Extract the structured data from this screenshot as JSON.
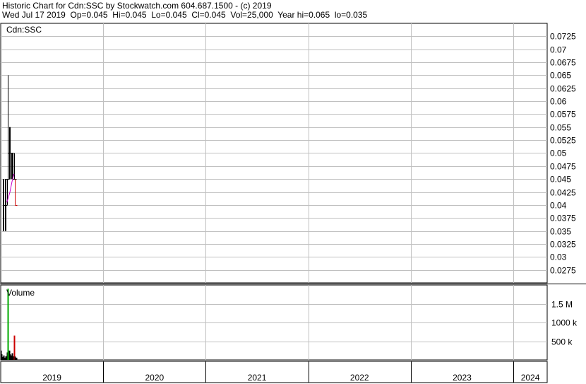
{
  "header": {
    "line1": "Historic Chart for Cdn:SSC by Stockwatch.com 604.687.1500 - (c) 2019",
    "line2": "Wed Jul 17 2019  Op=0.045  Hi=0.045  Lo=0.045  Cl=0.045  Vol=25,000  Year hi=0.065  lo=0.035"
  },
  "chart_data": [
    {
      "type": "ohlc",
      "title": "Cdn:SSC",
      "ylim": [
        0.025,
        0.075
      ],
      "yticks": [
        0.0275,
        0.03,
        0.0325,
        0.035,
        0.0375,
        0.04,
        0.0425,
        0.045,
        0.0475,
        0.05,
        0.0525,
        0.055,
        0.0575,
        0.06,
        0.0625,
        0.065,
        0.0675,
        0.07,
        0.0725
      ],
      "ytick_labels": [
        "0.0275",
        "0.03",
        "0.0325",
        "0.035",
        "0.0375",
        "0.04",
        "0.0425",
        "0.045",
        "0.0475",
        "0.05",
        "0.0525",
        "0.055",
        "0.0575",
        "0.06",
        "0.0625",
        "0.065",
        "0.0675",
        "0.07",
        "0.0725"
      ],
      "xlim": [
        2019.0,
        2024.33
      ],
      "xticks": [
        2019,
        2020,
        2021,
        2022,
        2023,
        2024
      ],
      "xtick_labels": [
        "2019",
        "2020",
        "2021",
        "2022",
        "2023",
        "2024"
      ],
      "grid": true,
      "colors": {
        "bar": "#000000",
        "last_bar": "#cc0000",
        "moving_average": "#cc00cc"
      },
      "bars": [
        {
          "x": 2019.02,
          "high": 0.045,
          "low": 0.035,
          "close": 0.04
        },
        {
          "x": 2019.03,
          "high": 0.045,
          "low": 0.035,
          "close": 0.04
        },
        {
          "x": 2019.04,
          "high": 0.045,
          "low": 0.035,
          "close": 0.04
        },
        {
          "x": 2019.05,
          "high": 0.045,
          "low": 0.035,
          "close": 0.045
        },
        {
          "x": 2019.06,
          "high": 0.045,
          "low": 0.04,
          "close": 0.045
        },
        {
          "x": 2019.07,
          "high": 0.065,
          "low": 0.045,
          "close": 0.05
        },
        {
          "x": 2019.08,
          "high": 0.055,
          "low": 0.045,
          "close": 0.05
        },
        {
          "x": 2019.09,
          "high": 0.055,
          "low": 0.045,
          "close": 0.05
        },
        {
          "x": 2019.1,
          "high": 0.05,
          "low": 0.045,
          "close": 0.05
        },
        {
          "x": 2019.11,
          "high": 0.05,
          "low": 0.045,
          "close": 0.045
        },
        {
          "x": 2019.12,
          "high": 0.05,
          "low": 0.045,
          "close": 0.045
        },
        {
          "x": 2019.13,
          "high": 0.05,
          "low": 0.045,
          "close": 0.045
        },
        {
          "x": 2019.14,
          "high": 0.045,
          "low": 0.04,
          "close": 0.04
        }
      ],
      "moving_average": [
        {
          "x": 2019.06,
          "y": 0.0405
        },
        {
          "x": 2019.09,
          "y": 0.0425
        },
        {
          "x": 2019.11,
          "y": 0.0445
        },
        {
          "x": 2019.13,
          "y": 0.046
        }
      ]
    },
    {
      "type": "bar",
      "title": "Volume",
      "ylim": [
        0,
        2000000
      ],
      "yticks": [
        500000,
        1000000,
        1500000
      ],
      "ytick_labels": [
        "500 k",
        "1000 k",
        "1.5 M"
      ],
      "xlim": [
        2019.0,
        2024.33
      ],
      "grid": true,
      "colors": {
        "bar": "#000000",
        "spike": "#00aa00",
        "last_bar": "#cc0000"
      },
      "bars": [
        {
          "x": 2019.0,
          "v": 250000
        },
        {
          "x": 2019.01,
          "v": 150000
        },
        {
          "x": 2019.02,
          "v": 80000
        },
        {
          "x": 2019.03,
          "v": 120000
        },
        {
          "x": 2019.04,
          "v": 60000
        },
        {
          "x": 2019.05,
          "v": 100000
        },
        {
          "x": 2019.06,
          "v": 200000
        },
        {
          "x": 2019.07,
          "v": 1900000,
          "highlight": true
        },
        {
          "x": 2019.08,
          "v": 250000
        },
        {
          "x": 2019.09,
          "v": 150000
        },
        {
          "x": 2019.1,
          "v": 120000
        },
        {
          "x": 2019.11,
          "v": 180000
        },
        {
          "x": 2019.12,
          "v": 100000
        },
        {
          "x": 2019.13,
          "v": 650000,
          "last": true
        },
        {
          "x": 2019.14,
          "v": 90000
        },
        {
          "x": 2019.15,
          "v": 60000
        }
      ]
    }
  ]
}
